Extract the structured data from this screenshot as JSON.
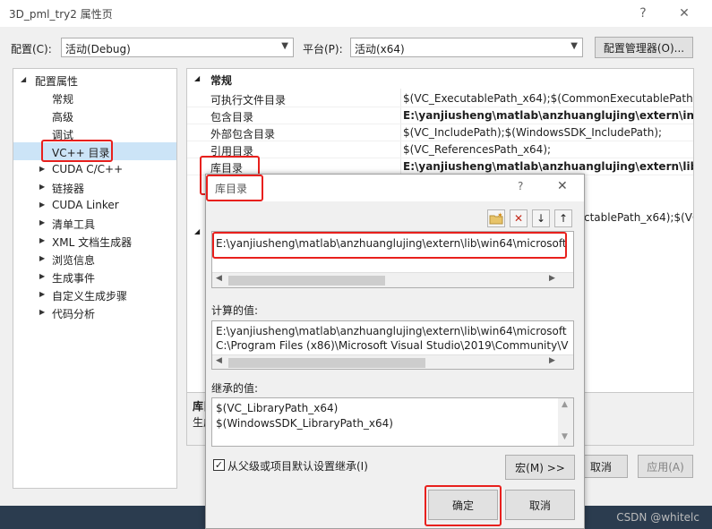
{
  "window": {
    "title": "3D_pml_try2 属性页",
    "help_glyph": "?",
    "close_glyph": "✕"
  },
  "config": {
    "config_label": "配置(C):",
    "config_value": "活动(Debug)",
    "platform_label": "平台(P):",
    "platform_value": "活动(x64)",
    "manager_button": "配置管理器(O)..."
  },
  "tree": {
    "root": "配置属性",
    "items": [
      "常规",
      "高级",
      "调试",
      "VC++ 目录",
      "CUDA C/C++",
      "链接器",
      "CUDA Linker",
      "清单工具",
      "XML 文档生成器",
      "浏览信息",
      "生成事件",
      "自定义生成步骤",
      "代码分析"
    ]
  },
  "grid": {
    "section": "常规",
    "rows": [
      {
        "name": "可执行文件目录",
        "value": "$(VC_ExecutablePath_x64);$(CommonExecutablePath)"
      },
      {
        "name": "包含目录",
        "value": "E:\\yanjiusheng\\matlab\\anzhuanglujing\\extern\\include"
      },
      {
        "name": "外部包含目录",
        "value": "$(VC_IncludePath);$(WindowsSDK_IncludePath);"
      },
      {
        "name": "引用目录",
        "value": "$(VC_ReferencesPath_x64);"
      },
      {
        "name": "库目录",
        "value": "E:\\yanjiusheng\\matlab\\anzhuanglujing\\extern\\lib\\win"
      }
    ],
    "partial_value": "ctablePath_x64);$(VC_E",
    "desc_title": "库目",
    "desc_text": "生成"
  },
  "main_buttons": {
    "cancel": "取消",
    "apply": "应用(A)"
  },
  "dialog": {
    "title": "库目录",
    "help_glyph": "?",
    "close_glyph": "✕",
    "tool_icons": [
      "new-folder-icon",
      "delete-icon",
      "move-down-icon",
      "move-up-icon"
    ],
    "entry": "E:\\yanjiusheng\\matlab\\anzhuanglujing\\extern\\lib\\win64\\microsoft",
    "computed_label": "计算的值:",
    "computed": [
      "E:\\yanjiusheng\\matlab\\anzhuanglujing\\extern\\lib\\win64\\microsoft",
      "C:\\Program Files (x86)\\Microsoft Visual Studio\\2019\\Community\\V"
    ],
    "inherited_label": "继承的值:",
    "inherited": [
      "$(VC_LibraryPath_x64)",
      "$(WindowsSDK_LibraryPath_x64)"
    ],
    "inherit_checkbox": "从父级或项目默认设置继承(I)",
    "macro_button": "宏(M) >>",
    "ok_button": "确定",
    "cancel_button": "取消"
  },
  "watermark": "CSDN @whitelc",
  "colors": {
    "highlight": "#e8201d",
    "selection": "#cce4f7"
  }
}
